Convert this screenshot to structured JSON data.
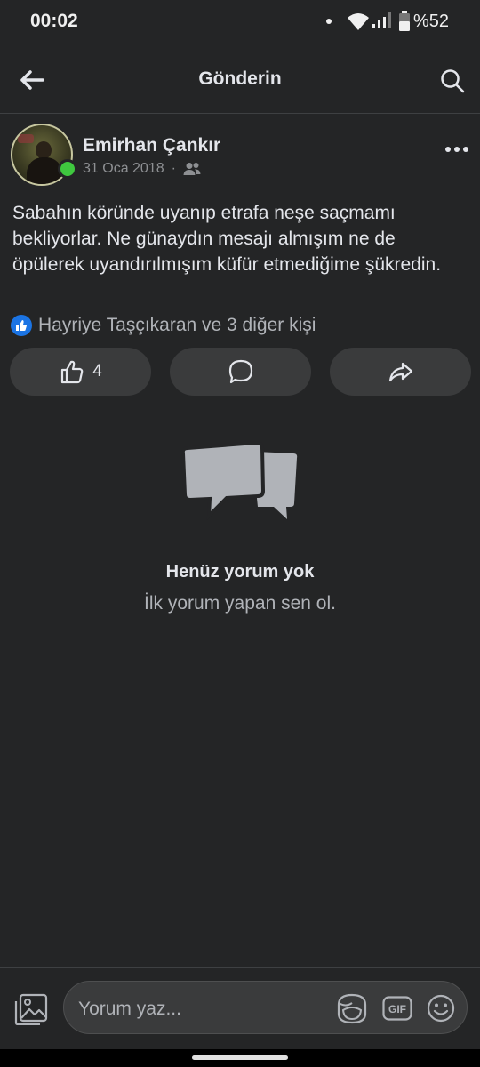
{
  "status_bar": {
    "time": "00:02",
    "battery": "%52"
  },
  "header": {
    "title": "Gönderin",
    "back_icon": "arrow-left-icon",
    "search_icon": "search-icon"
  },
  "post": {
    "author": "Emirhan Çankır",
    "date": "31 Oca 2018",
    "separator": "·",
    "audience_icon": "friends-icon",
    "online": true,
    "text": "Sabahın köründe uyanıp etrafa neşe saçmamı bekliyorlar. Ne günaydın mesajı almışım ne de öpülerek uyandırılmışım küfür etmediğime şükredin.",
    "reactions_text": "Hayriye Taşçıkaran ve 3 diğer kişi",
    "like_count": "4"
  },
  "actions": {
    "like_icon": "thumbs-up-icon",
    "comment_icon": "comment-bubble-icon",
    "share_icon": "share-arrow-icon"
  },
  "empty_comments": {
    "title": "Henüz yorum yok",
    "subtitle": "İlk yorum yapan sen ol."
  },
  "composer": {
    "placeholder": "Yorum yaz...",
    "photo_icon": "photo-icon",
    "sticker_icon": "sticker-icon",
    "gif_label": "GIF",
    "emoji_icon": "emoji-icon"
  },
  "colors": {
    "background": "#242526",
    "button_bg": "#3a3b3c",
    "like_badge": "#1b74e4",
    "online": "#3fc83f"
  }
}
